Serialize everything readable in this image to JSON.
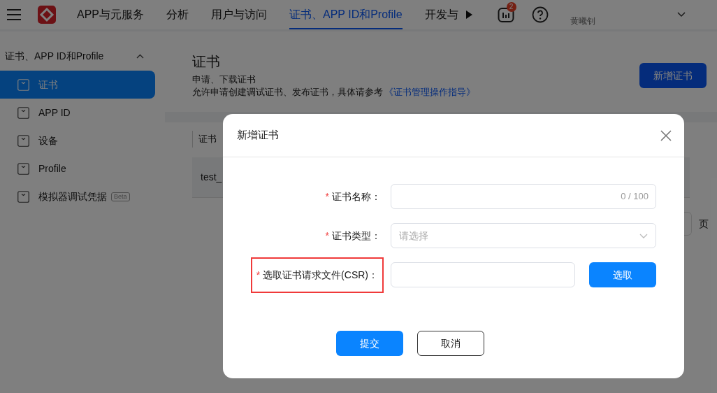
{
  "header": {
    "nav": [
      {
        "label": "APP与元服务",
        "selected": false
      },
      {
        "label": "分析",
        "selected": false
      },
      {
        "label": "用户与访问",
        "selected": false
      },
      {
        "label": "证书、APP ID和Profile",
        "selected": true
      },
      {
        "label": "开发与",
        "selected": false
      }
    ],
    "notification_count": "2",
    "user_name": "黄曦钊"
  },
  "sidebar": {
    "group": {
      "title": "证书、APP ID和Profile",
      "expanded": true
    },
    "items": [
      {
        "label": "证书",
        "selected": true
      },
      {
        "label": "APP ID",
        "selected": false
      },
      {
        "label": "设备",
        "selected": false
      },
      {
        "label": "Profile",
        "selected": false
      },
      {
        "label": "模拟器调试凭据",
        "selected": false,
        "badge": "Beta"
      }
    ]
  },
  "page": {
    "title": "证书",
    "subtitle": "申请、下载证书",
    "description": "允许申请创建调试证书、发布证书，具体请参考",
    "link": "《证书管理操作指导》",
    "add_button": "新增证书"
  },
  "table": {
    "columns": [
      "证书"
    ],
    "rows": [
      [
        "test_"
      ]
    ],
    "pagination_text": "页"
  },
  "dialog": {
    "title": "新增证书",
    "required_mark": "*",
    "fields": [
      {
        "kind": "text",
        "label": "证书名称：",
        "required": true,
        "counter": "0 / 100",
        "highlighted": false
      },
      {
        "kind": "select",
        "label": "证书类型：",
        "required": true,
        "placeholder": "请选择",
        "highlighted": false
      },
      {
        "kind": "file",
        "label": "选取证书请求文件(CSR)：",
        "required": true,
        "button": "选取",
        "highlighted": true
      }
    ],
    "buttons": [
      {
        "label": "提交",
        "primary": true
      },
      {
        "label": "取消",
        "primary": false
      }
    ]
  }
}
